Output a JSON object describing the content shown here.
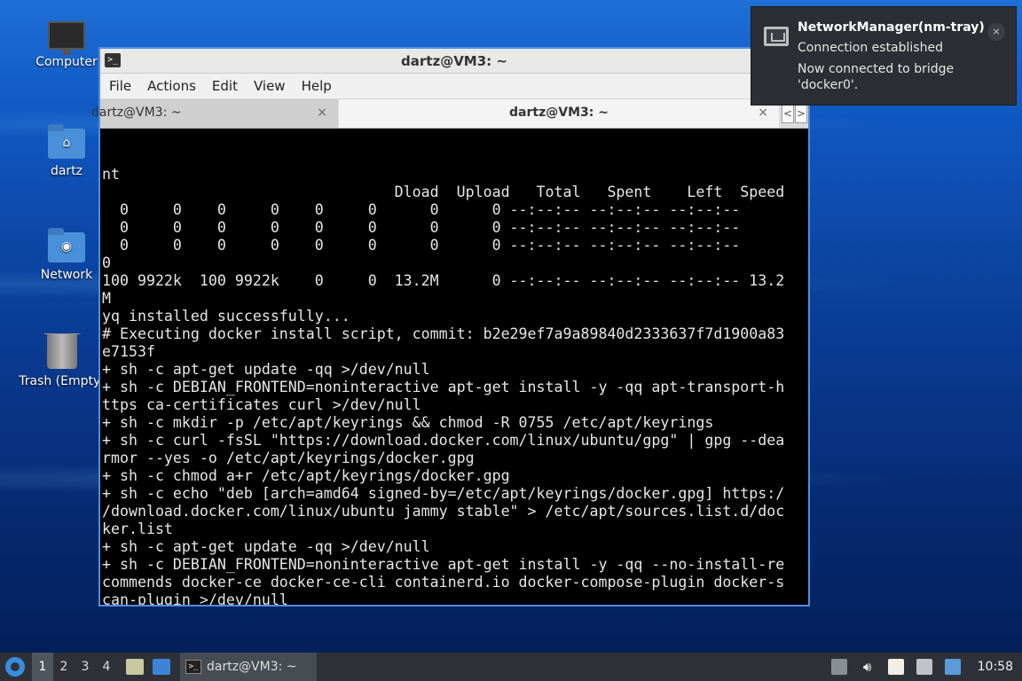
{
  "desktop": {
    "icons": [
      {
        "label": "Computer"
      },
      {
        "label": "dartz"
      },
      {
        "label": "Network"
      },
      {
        "label": "Trash (Empty)"
      }
    ]
  },
  "window": {
    "title": "dartz@VM3: ~",
    "menu": [
      "File",
      "Actions",
      "Edit",
      "View",
      "Help"
    ],
    "tabs": [
      {
        "label": "dartz@VM3: ~",
        "active": false
      },
      {
        "label": "dartz@VM3: ~",
        "active": true
      }
    ],
    "close_glyph": "×",
    "scroll_left": "<",
    "scroll_right": ">"
  },
  "terminal": {
    "lines": [
      "nt",
      "                                 Dload  Upload   Total   Spent    Left  Speed",
      "  0     0    0     0    0     0      0      0 --:--:-- --:--:-- --:--:--",
      "  0     0    0     0    0     0      0      0 --:--:-- --:--:-- --:--:--",
      "  0     0    0     0    0     0      0      0 --:--:-- --:--:-- --:--:--",
      "0",
      "100 9922k  100 9922k    0     0  13.2M      0 --:--:-- --:--:-- --:--:-- 13.2",
      "M",
      "yq installed successfully...",
      "# Executing docker install script, commit: b2e29ef7a9a89840d2333637f7d1900a83",
      "e7153f",
      "+ sh -c apt-get update -qq >/dev/null",
      "+ sh -c DEBIAN_FRONTEND=noninteractive apt-get install -y -qq apt-transport-h",
      "ttps ca-certificates curl >/dev/null",
      "+ sh -c mkdir -p /etc/apt/keyrings && chmod -R 0755 /etc/apt/keyrings",
      "+ sh -c curl -fsSL \"https://download.docker.com/linux/ubuntu/gpg\" | gpg --dea",
      "rmor --yes -o /etc/apt/keyrings/docker.gpg",
      "+ sh -c chmod a+r /etc/apt/keyrings/docker.gpg",
      "+ sh -c echo \"deb [arch=amd64 signed-by=/etc/apt/keyrings/docker.gpg] https:/",
      "/download.docker.com/linux/ubuntu jammy stable\" > /etc/apt/sources.list.d/doc",
      "ker.list",
      "+ sh -c apt-get update -qq >/dev/null",
      "+ sh -c DEBIAN_FRONTEND=noninteractive apt-get install -y -qq --no-install-re",
      "commends docker-ce docker-ce-cli containerd.io docker-compose-plugin docker-s",
      "can-plugin >/dev/null"
    ]
  },
  "notification": {
    "title": "NetworkManager(nm-tray)",
    "summary": "Connection established",
    "body": "Now connected to bridge 'docker0'.",
    "close_glyph": "×",
    "icon": "network-wired-icon"
  },
  "taskbar": {
    "workspaces": [
      "1",
      "2",
      "3",
      "4"
    ],
    "active_workspace": "1",
    "task_label": "dartz@VM3: ~",
    "terminal_glyph": ">_",
    "clock": "10:58"
  }
}
